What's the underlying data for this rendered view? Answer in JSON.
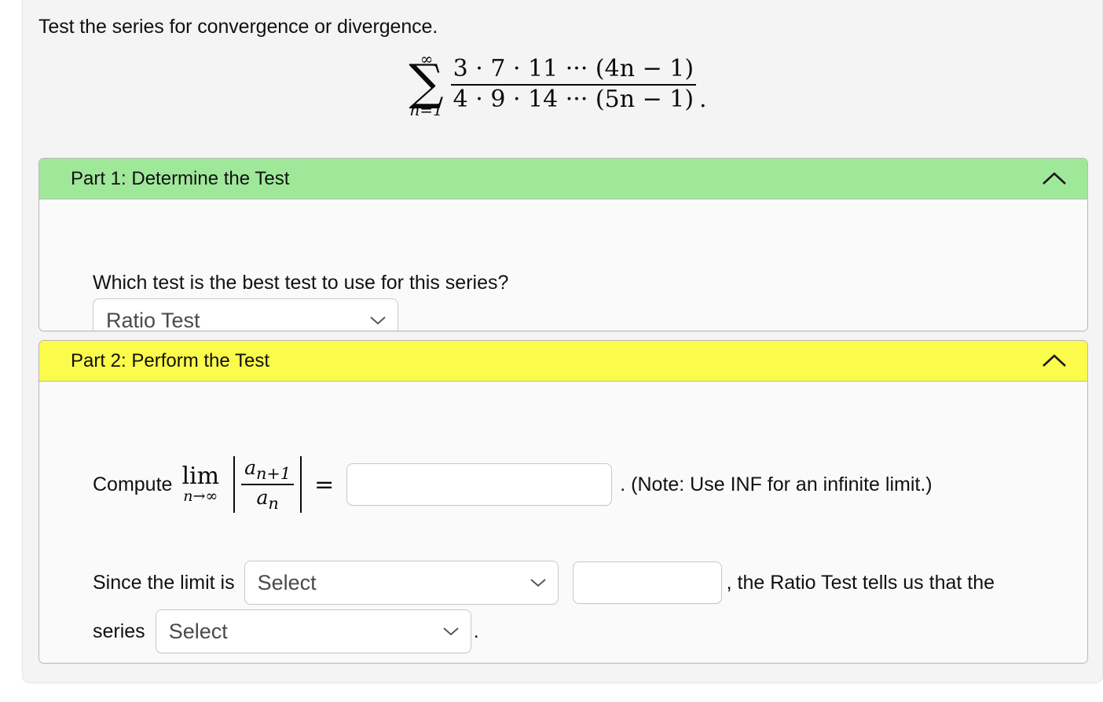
{
  "prompt": "Test the series for convergence or divergence.",
  "series": {
    "sum_upper": "∞",
    "sum_lower": "n=1",
    "numerator": "3 · 7 · 11 ··· (4n − 1)",
    "denominator": "4 · 9 · 14 ··· (5n − 1)",
    "trailing_punctuation": "."
  },
  "parts": [
    {
      "title": "Part 1: Determine the Test",
      "header_color": "#9fe89a",
      "collapse_icon": "chevron-up-icon",
      "question": "Which test is the best test to use for this series?",
      "select_value": "Ratio Test",
      "trailing_punctuation": "."
    },
    {
      "title": "Part 2: Perform the Test",
      "header_color": "#fbfb4c",
      "collapse_icon": "chevron-up-icon",
      "compute_label": "Compute",
      "limit_operator": "lim",
      "limit_subscript": "n→∞",
      "limit_numerator": "a",
      "limit_numerator_sub": "n+1",
      "limit_denominator": "a",
      "limit_denominator_sub": "n",
      "equals": "=",
      "limit_input_value": "",
      "limit_input_placeholder": "",
      "note": ". (Note: Use INF for an infinite limit.)",
      "since_lead": "Since the limit is",
      "limit_compare_value": "Select",
      "compare_value_input": "",
      "since_tail": ", the Ratio Test tells us that the",
      "series_lead": "series",
      "series_result_value": "Select",
      "series_trailing_punctuation": "."
    }
  ]
}
